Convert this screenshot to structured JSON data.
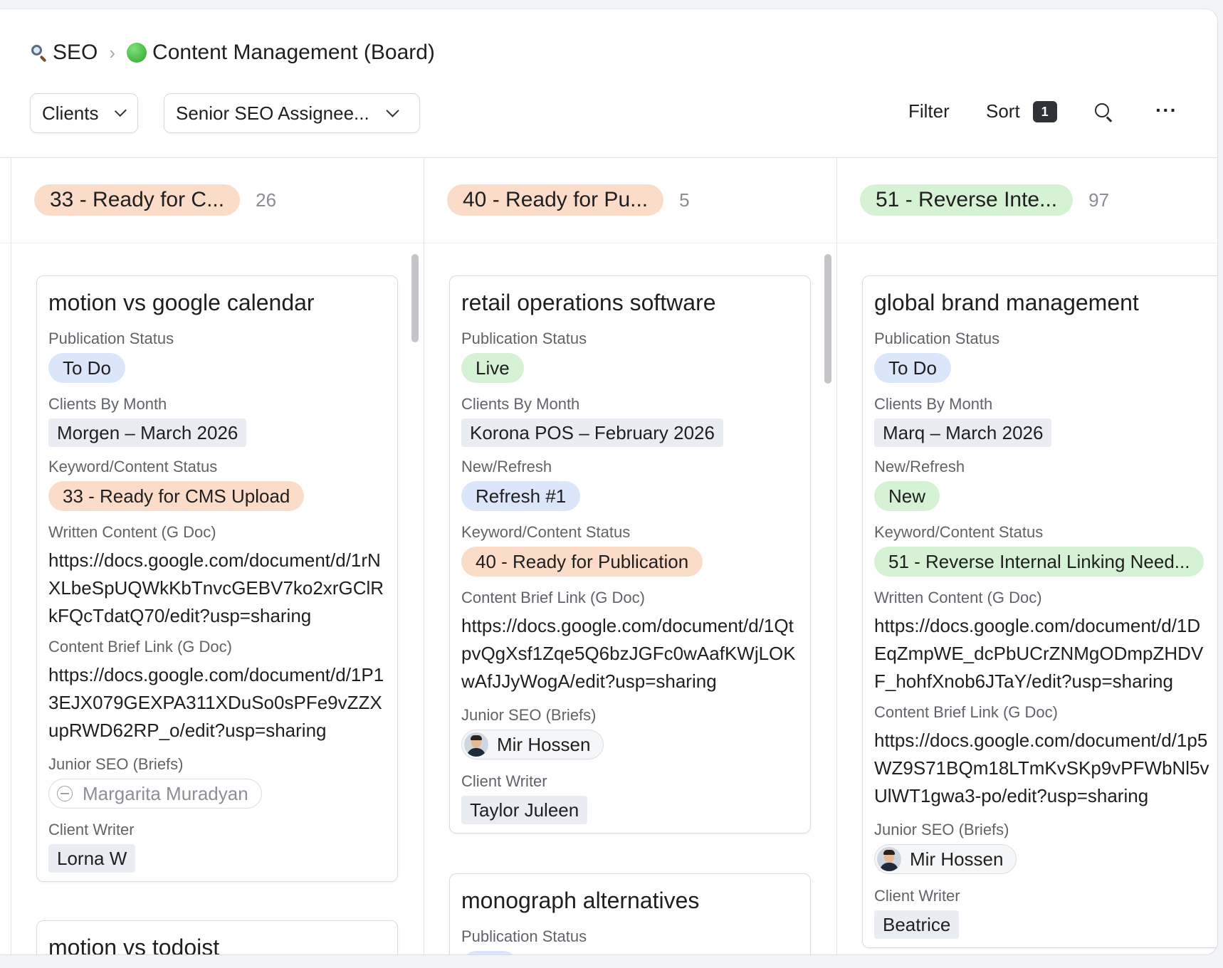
{
  "breadcrumb": {
    "parent": "SEO",
    "separator": "›",
    "title": "Content Management (Board)"
  },
  "toolbar": {
    "filters": [
      {
        "label": "Clients"
      },
      {
        "label": "Senior SEO Assignee..."
      }
    ],
    "filter_label": "Filter",
    "sort_label": "Sort",
    "sort_count": "1"
  },
  "columns": [
    {
      "status": "33 - Ready for C...",
      "count": "26",
      "color": "#fbdcc8",
      "cards": [
        {
          "title": "motion vs google calendar",
          "publication_status_label": "Publication Status",
          "publication_status": "To Do",
          "clients_by_month_label": "Clients By Month",
          "clients_by_month": "Morgen – March 2026",
          "keyword_status_label": "Keyword/Content Status",
          "keyword_status": "33 - Ready for CMS Upload",
          "written_content_label": "Written Content (G Doc)",
          "written_content": "https://docs.google.com/document/d/1rNXLbeSpUQWkKbTnvcGEBV7ko2xrGClRkFQcTdatQ70/edit?usp=sharing",
          "brief_link_label": "Content Brief Link (G Doc)",
          "brief_link": "https://docs.google.com/document/d/1P13EJX079GEXPA311XDuSo0sPFe9vZZXupRWD62RP_o/edit?usp=sharing",
          "junior_seo_label": "Junior SEO (Briefs)",
          "junior_seo": "Margarita Muradyan",
          "client_writer_label": "Client Writer",
          "client_writer": "Lorna W"
        },
        {
          "title": "motion vs todoist"
        }
      ]
    },
    {
      "status": "40 - Ready for Pu...",
      "count": "5",
      "color": "#fbdcc8",
      "cards": [
        {
          "title": "retail operations software",
          "publication_status_label": "Publication Status",
          "publication_status": "Live",
          "clients_by_month_label": "Clients By Month",
          "clients_by_month": "Korona POS – February 2026",
          "new_refresh_label": "New/Refresh",
          "new_refresh": "Refresh #1",
          "keyword_status_label": "Keyword/Content Status",
          "keyword_status": "40 - Ready for Publication",
          "brief_link_label": "Content Brief Link (G Doc)",
          "brief_link": "https://docs.google.com/document/d/1QtpvQgXsf1Zqe5Q6bzJGFc0wAafKWjLOKwAfJJyWogA/edit?usp=sharing",
          "junior_seo_label": "Junior SEO (Briefs)",
          "junior_seo": "Mir Hossen",
          "client_writer_label": "Client Writer",
          "client_writer": "Taylor Juleen"
        },
        {
          "title": "monograph alternatives",
          "publication_status_label": "Publication Status"
        }
      ]
    },
    {
      "status": "51 - Reverse Inte...",
      "count": "97",
      "color": "#d6f2d4",
      "cards": [
        {
          "title": "global brand management",
          "publication_status_label": "Publication Status",
          "publication_status": "To Do",
          "clients_by_month_label": "Clients By Month",
          "clients_by_month": "Marq – March 2026",
          "new_refresh_label": "New/Refresh",
          "new_refresh": "New",
          "keyword_status_label": "Keyword/Content Status",
          "keyword_status": "51 - Reverse Internal Linking Need...",
          "written_content_label": "Written Content (G Doc)",
          "written_content": "https://docs.google.com/document/d/1DEqZmpWE_dcPbUCrZNMgODmpZHDVF_hohfXnob6JTaY/edit?usp=sharing",
          "brief_link_label": "Content Brief Link (G Doc)",
          "brief_link": "https://docs.google.com/document/d/1p5WZ9S71BQm18LTmKvSKp9vPFWbNl5vUlWT1gwa3-po/edit?usp=sharing",
          "junior_seo_label": "Junior SEO (Briefs)",
          "junior_seo": "Mir Hossen",
          "client_writer_label": "Client Writer",
          "client_writer": "Beatrice"
        }
      ]
    }
  ],
  "colors": {
    "peach": "#fbdcc8",
    "green": "#d6f2d4",
    "blue": "#dbe6fb",
    "grey_tag": "#e9ecf3"
  }
}
